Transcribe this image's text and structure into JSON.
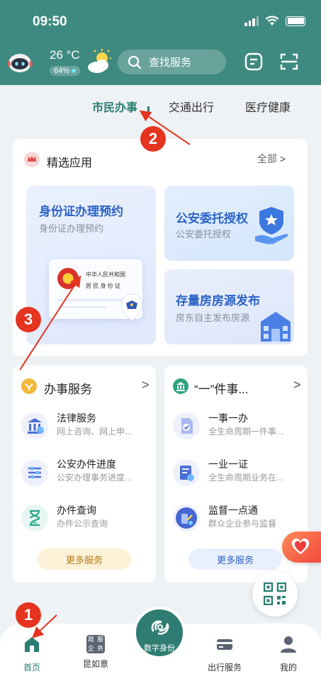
{
  "status_bar": {
    "time": "09:50"
  },
  "header": {
    "temperature": "26 °C",
    "humidity": "64%",
    "search_placeholder": "查找服务",
    "icons": [
      "robot-avatar-icon",
      "partly-cloudy-icon",
      "search-icon",
      "message-icon",
      "scan-icon"
    ]
  },
  "tabs": [
    {
      "label": "市民办事",
      "active": true
    },
    {
      "label": "交通出行",
      "active": false
    },
    {
      "label": "医疗健康",
      "active": false
    }
  ],
  "featured": {
    "title": "精选应用",
    "more_label": "全部",
    "tiles": [
      {
        "title": "身份证办理预约",
        "subtitle": "身份证办理预约",
        "card_text_1": "中华人民共和国",
        "card_text_2": "居 民 身 份 证"
      },
      {
        "title": "公安委托授权",
        "subtitle": "公安委托授权"
      },
      {
        "title": "存量房房源发布",
        "subtitle": "房东自主发布房源"
      }
    ]
  },
  "affairs": {
    "title": "办事服务",
    "items": [
      {
        "title": "法律服务",
        "subtitle": "网上咨询、网上申..."
      },
      {
        "title": "公安办件进度",
        "subtitle": "公安办理事务进度..."
      },
      {
        "title": "办件查询",
        "subtitle": "办件公示查询"
      }
    ],
    "more_label": "更多服务"
  },
  "oneitem": {
    "title": "“一”件事...",
    "items": [
      {
        "title": "一事一办",
        "subtitle": "全生命周期一件事..."
      },
      {
        "title": "一业一证",
        "subtitle": "全生命周期业务在..."
      },
      {
        "title": "监督一点通",
        "subtitle": "群众企业参与监督"
      }
    ],
    "more_label": "更多服务"
  },
  "tabbar": {
    "items": [
      {
        "label": "首页",
        "active": true
      },
      {
        "label": "昆如意",
        "active": false
      },
      {
        "label": "出行服务",
        "active": false
      },
      {
        "label": "我的",
        "active": false
      }
    ],
    "center_label": "数字身份",
    "kunruyi_icon_text": [
      "政",
      "服",
      "企",
      "务"
    ]
  },
  "annotations": [
    "1",
    "2",
    "3"
  ],
  "colors": {
    "header": "#3f8a80",
    "accent": "#2a7f73",
    "tile_blue": "#2c63c7",
    "annotation_red": "#e53420"
  }
}
